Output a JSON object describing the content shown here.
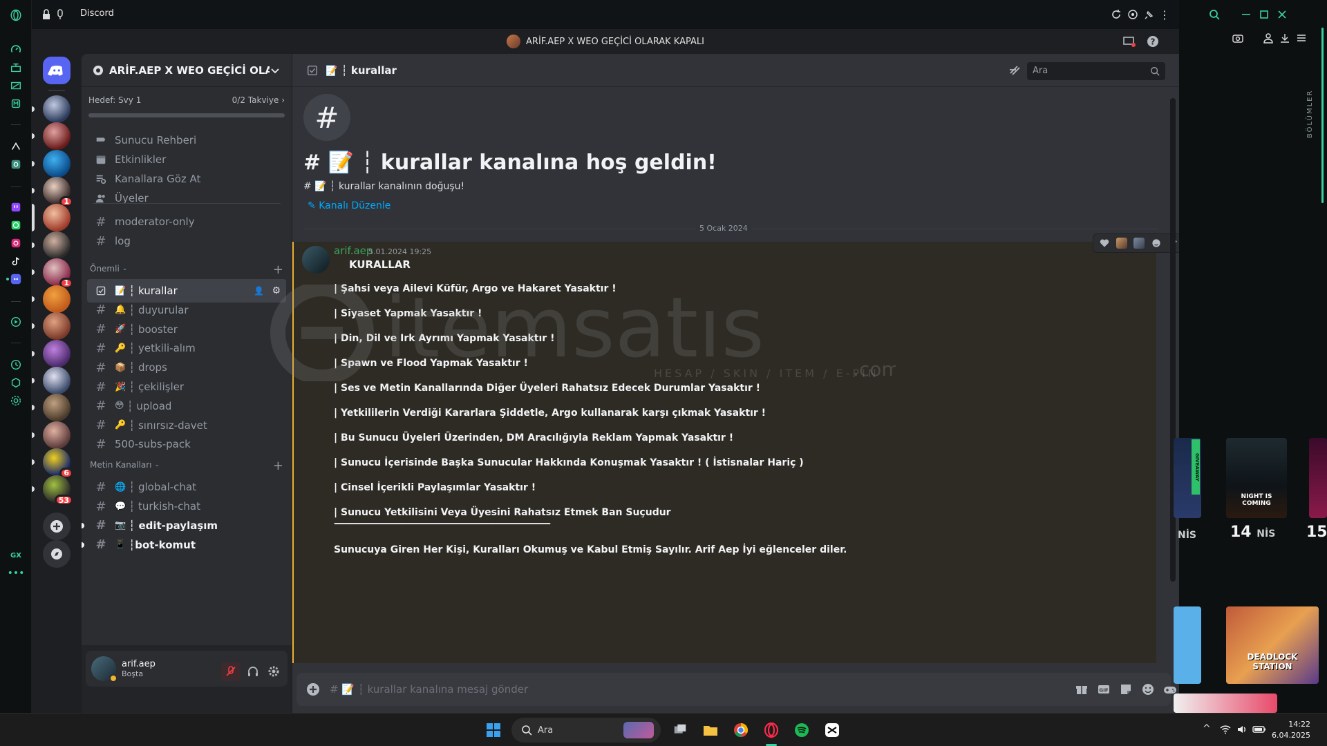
{
  "browser": {
    "tab_title": "Discord",
    "colors": {
      "accent": "#3cd0a0"
    }
  },
  "window": {
    "title": "ARİF.AEP X WEO GEÇİCİ OLARAK KAPALI"
  },
  "servers": [
    {
      "name": "server-1",
      "badge": ""
    },
    {
      "name": "server-2",
      "badge": ""
    },
    {
      "name": "server-3",
      "badge": ""
    },
    {
      "name": "server-4",
      "badge": "1"
    },
    {
      "name": "server-5",
      "badge": ""
    },
    {
      "name": "server-6",
      "badge": ""
    },
    {
      "name": "server-7",
      "badge": "1"
    },
    {
      "name": "server-8",
      "badge": ""
    },
    {
      "name": "server-9",
      "badge": ""
    },
    {
      "name": "server-10",
      "badge": ""
    },
    {
      "name": "server-11",
      "badge": ""
    },
    {
      "name": "server-12",
      "badge": ""
    },
    {
      "name": "server-13",
      "badge": ""
    },
    {
      "name": "server-14",
      "badge": "6"
    },
    {
      "name": "server-15",
      "badge": "53"
    }
  ],
  "sidebar": {
    "server_name": "ARİF.AEP X WEO GEÇİCİ OLA...",
    "boost_goal": "Hedef: Svy 1",
    "boost_count": "0/2 Takviye",
    "nav": [
      {
        "label": "Sunucu Rehberi",
        "icon": "guide-icon"
      },
      {
        "label": "Etkinlikler",
        "icon": "calendar-icon"
      },
      {
        "label": "Kanallara Göz At",
        "icon": "browse-channels-icon"
      },
      {
        "label": "Üyeler",
        "icon": "members-icon"
      }
    ],
    "plain_channels": [
      "moderator-only",
      "log"
    ],
    "categories": [
      {
        "name": "Önemli",
        "channels": [
          {
            "emoji": "📝",
            "label": "┆ kurallar",
            "active": true
          },
          {
            "emoji": "🔔",
            "label": "┆ duyurular"
          },
          {
            "emoji": "🚀",
            "label": "┆ booster"
          },
          {
            "emoji": "🔑",
            "label": "┆ yetkili-alım"
          },
          {
            "emoji": "📦",
            "label": "┆ drops"
          },
          {
            "emoji": "🎉",
            "label": "┆ çekilişler"
          },
          {
            "emoji": "😳",
            "label": "┆ upload"
          },
          {
            "emoji": "🔑",
            "label": "┆ sınırsız-davet"
          },
          {
            "emoji": "",
            "label": "500-subs-pack"
          }
        ]
      },
      {
        "name": "Metin Kanalları",
        "channels": [
          {
            "emoji": "🌐",
            "label": "┆ global-chat"
          },
          {
            "emoji": "💬",
            "label": "┆ turkish-chat"
          },
          {
            "emoji": "📷",
            "label": "┆ edit-paylaşım",
            "unread": true
          },
          {
            "emoji": "📱",
            "label": "┆bot-komut",
            "unread": true
          }
        ]
      }
    ]
  },
  "user": {
    "name": "arif.aep",
    "status": "Boşta"
  },
  "chat": {
    "channel": "┆ kurallar",
    "search_placeholder": "Ara",
    "welcome_title": "# 📝 ┆ kurallar kanalına hoş geldin!",
    "welcome_sub": "# 📝 ┆ kurallar kanalının doğuşu!",
    "edit_label": "Kanalı Düzenle",
    "date_divider": "5 Ocak 2024",
    "message": {
      "author": "arif.aep",
      "timestamp": "5.01.2024 19:25",
      "heading": "KURALLAR",
      "rules": [
        "| Şahsi veya Ailevi Küfür, Argo ve Hakaret Yasaktır !",
        "| Siyaset Yapmak Yasaktır !",
        "| Din, Dil ve Irk Ayrımı Yapmak Yasaktır !",
        "| Spawn ve Flood Yapmak Yasaktır !",
        "| Ses ve Metin Kanallarında Diğer Üyeleri Rahatsız Edecek Durumlar Yasaktır !",
        "| Yetkililerin Verdiği Kararlara Şiddetle, Argo kullanarak karşı çıkmak Yasaktır !",
        "| Bu Sunucu Üyeleri Üzerinden, DM Aracılığıyla Reklam Yapmak Yasaktır !",
        "| Sunucu İçerisinde Başka Sunucular Hakkında Konuşmak Yasaktır ! ( İstisnalar Hariç )",
        "| Cinsel İçerikli Paylaşımlar Yasaktır !",
        "|  Sunucu Yetkilisini Veya Üyesini Rahatsız Etmek Ban Suçudur",
        "——————————————————————————",
        "Sunucuya Giren Her Kişi, Kuralları Okumuş ve Kabul Etmiş Sayılır. Arif Aep  İyi eğlenceler diler."
      ]
    },
    "composer_placeholder": "# 📝 ┆ kurallar kanalına mesaj gönder",
    "watermark": {
      "brand": "itemsatıs",
      "tagline": "HESAP / SKIN / ITEM / E-PIN",
      "suffix": ".com"
    }
  },
  "right_panel": {
    "section_label": "BÖLÜMLER",
    "dates": [
      {
        "day": "",
        "month": "NİS"
      },
      {
        "day": "14",
        "month": "NİS"
      },
      {
        "day": "15",
        "month": ""
      }
    ],
    "game_captions": [
      "NIGHT IS COMING",
      "DEADLOCK STATION",
      "GIVEAWAY"
    ]
  },
  "taskbar": {
    "search_placeholder": "Ara",
    "time": "14:22",
    "date": "6.04.2025"
  }
}
